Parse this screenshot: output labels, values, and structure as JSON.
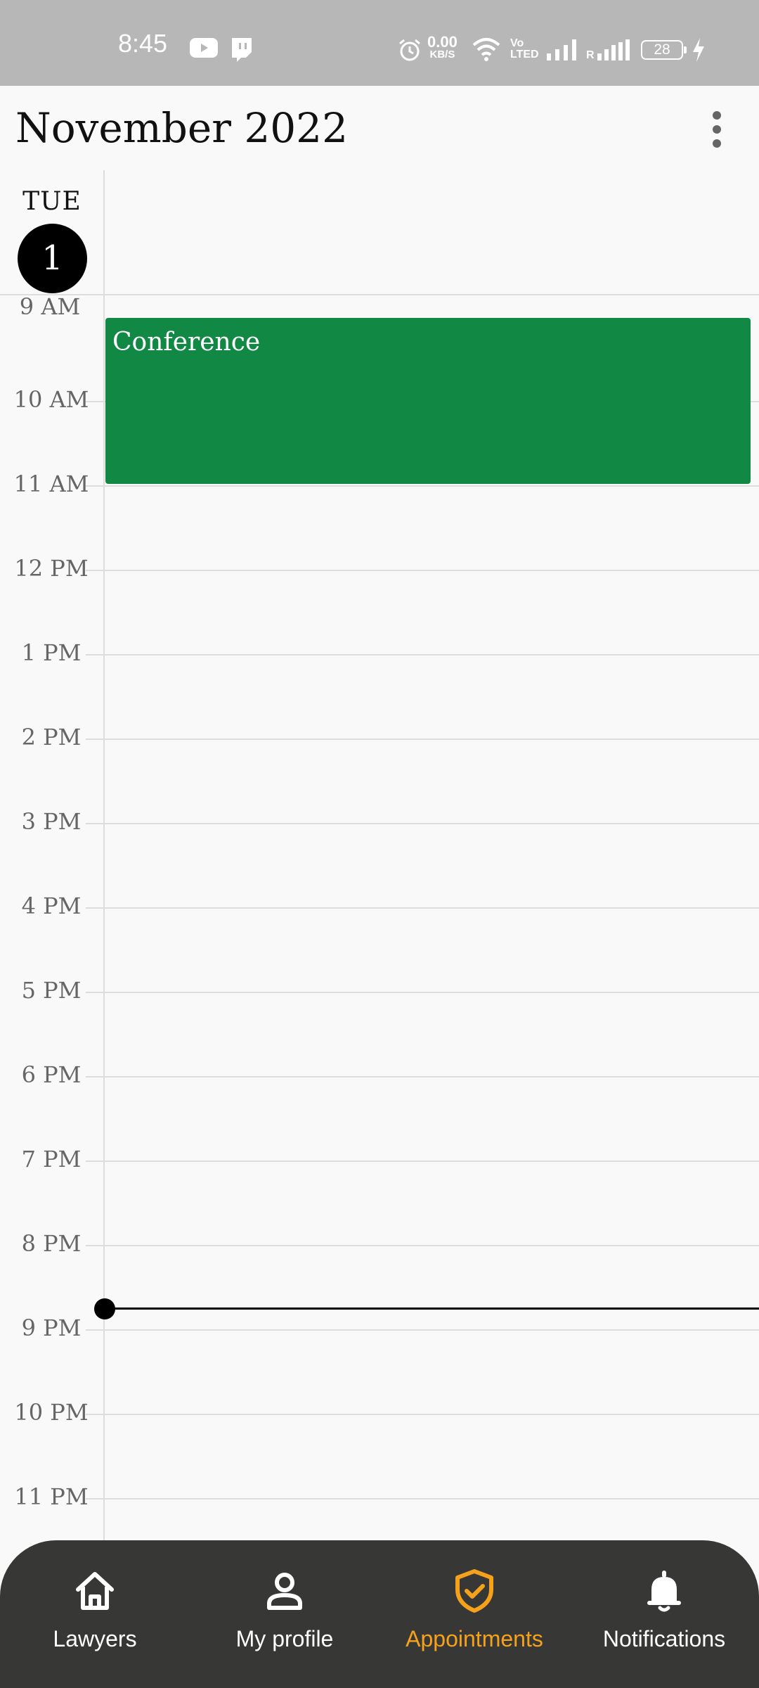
{
  "status_bar": {
    "time": "8:45",
    "net_speed": "0.00",
    "net_speed_unit": "KB/S",
    "volte_line1": "Vo",
    "volte_line2": "LTED",
    "roaming": "R",
    "battery": "28"
  },
  "header": {
    "title": "November 2022"
  },
  "day": {
    "name": "TUE",
    "number": "1"
  },
  "hours": [
    "9 AM",
    "10 AM",
    "11 AM",
    "12 PM",
    "1 PM",
    "2 PM",
    "3 PM",
    "4 PM",
    "5 PM",
    "6 PM",
    "7 PM",
    "8 PM",
    "9 PM",
    "10 PM",
    "11 PM"
  ],
  "events": [
    {
      "title": "Conference",
      "color": "#128845"
    }
  ],
  "nav": {
    "items": [
      {
        "label": "Lawyers",
        "icon": "home-icon"
      },
      {
        "label": "My profile",
        "icon": "person-icon"
      },
      {
        "label": "Appointments",
        "icon": "shield-check-icon",
        "active": true
      },
      {
        "label": "Notifications",
        "icon": "bell-icon"
      }
    ],
    "active_color": "#f5a11c",
    "background": "#373836"
  }
}
